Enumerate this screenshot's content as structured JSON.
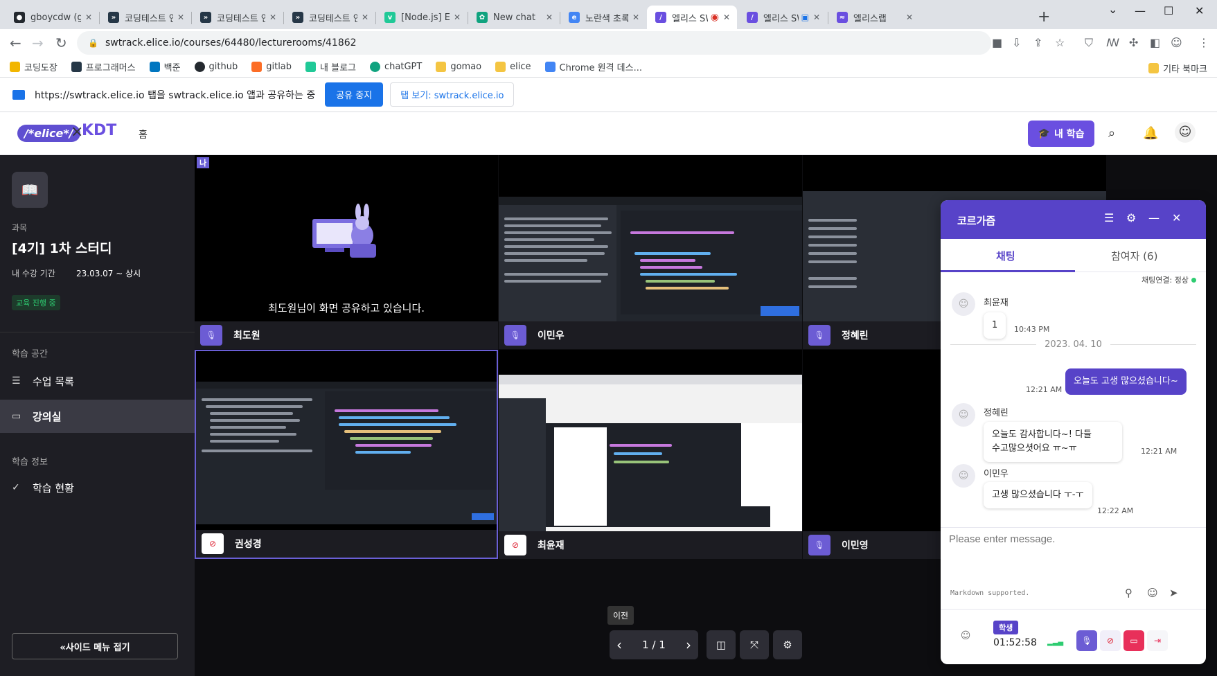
{
  "browser": {
    "tabs": [
      {
        "title": "gboycdw (gom",
        "icon": "github-icon",
        "color": "#24292f"
      },
      {
        "title": "코딩테스트 연습",
        "icon": "programmers-icon",
        "color": "#263747"
      },
      {
        "title": "코딩테스트 연습",
        "icon": "programmers-icon",
        "color": "#263747"
      },
      {
        "title": "코딩테스트 연습",
        "icon": "programmers-icon",
        "color": "#263747"
      },
      {
        "title": "[Node.js] Expre",
        "icon": "velog-icon",
        "color": "#20c997"
      },
      {
        "title": "New chat",
        "icon": "chatgpt-icon",
        "color": "#10a37f"
      },
      {
        "title": "노란색 초록색",
        "icon": "browser-icon",
        "color": "#4285f4"
      },
      {
        "title": "엘리스 SW",
        "icon": "elice-icon",
        "color": "#6a4fe0",
        "active": true,
        "recording": true
      },
      {
        "title": "엘리스 SW",
        "icon": "elice-icon",
        "color": "#6a4fe0"
      },
      {
        "title": "엘리스랩",
        "icon": "elicelab-icon",
        "color": "#6a4fe0"
      }
    ],
    "url": "swtrack.elice.io/courses/64480/lecturerooms/41862",
    "bookmarks": [
      {
        "label": "코딩도장",
        "color": "#f2b600"
      },
      {
        "label": "프로그래머스",
        "color": "#263747"
      },
      {
        "label": "백준",
        "color": "#0076c0"
      },
      {
        "label": "github",
        "color": "#24292f"
      },
      {
        "label": "gitlab",
        "color": "#fc6d26"
      },
      {
        "label": "내 블로그",
        "color": "#20c997"
      },
      {
        "label": "chatGPT",
        "color": "#10a37f"
      },
      {
        "label": "gomao",
        "color": "#f4c542"
      },
      {
        "label": "elice",
        "color": "#f4c542"
      },
      {
        "label": "Chrome 원격 데스...",
        "color": "#4285f4"
      }
    ],
    "bookmarks_other": "기타 북마크",
    "share_bar": {
      "message": "https://swtrack.elice.io 탭을 swtrack.elice.io 앱과 공유하는 중",
      "stop_label": "공유 중지",
      "tab_label": "탭 보기: swtrack.elice.io"
    }
  },
  "header": {
    "logo_text": "/*elice*/",
    "logo_x": "×",
    "logo_kdt": "KDT",
    "home": "홈",
    "my_learning": "내 학습"
  },
  "sidebar": {
    "course_label": "과목",
    "course_title": "[4기] 1차 스터디",
    "period_label": "내 수강 기간",
    "period_value": "23.03.07 ~ 상시",
    "status": "교육 진행 중",
    "section_space": "학습 공간",
    "item_lessons": "수업 목록",
    "item_lecture": "강의실",
    "section_info": "학습 정보",
    "item_progress": "학습 현황",
    "collapse": "«사이드 메뉴 접기"
  },
  "grid": {
    "me_badge": "나",
    "sharing_message": "최도원님이 화면 공유하고 있습니다.",
    "tiles": [
      {
        "name": "최도원"
      },
      {
        "name": "이민우"
      },
      {
        "name": "정혜린"
      },
      {
        "name": "권성경"
      },
      {
        "name": "최윤재"
      },
      {
        "name": "이민영"
      }
    ],
    "page": "1 / 1",
    "prev_tooltip": "이전"
  },
  "chat": {
    "title": "코르가즘",
    "tab_chat": "채팅",
    "tab_participants": "참여자 (6)",
    "connection": "채팅연결: 정상",
    "date": "2023. 04. 10",
    "messages": [
      {
        "name": "최윤재",
        "text": "1",
        "time": "10:43 PM"
      },
      {
        "text": "오늘도 고생 많으셨습니다~",
        "time": "12:21 AM"
      },
      {
        "name": "정혜린",
        "text_1": "오늘도 감사합니다~! 다들",
        "text_2": "수고많으셧어요 ㅠ~ㅠ",
        "time": "12:21 AM"
      },
      {
        "name": "이민우",
        "text": "고생 많으셨습니다 ㅜ-ㅜ",
        "time": "12:22 AM"
      }
    ],
    "input_placeholder": "Please enter message.",
    "markdown_note": "Markdown supported.",
    "role": "학생",
    "timer": "01:52:58"
  }
}
